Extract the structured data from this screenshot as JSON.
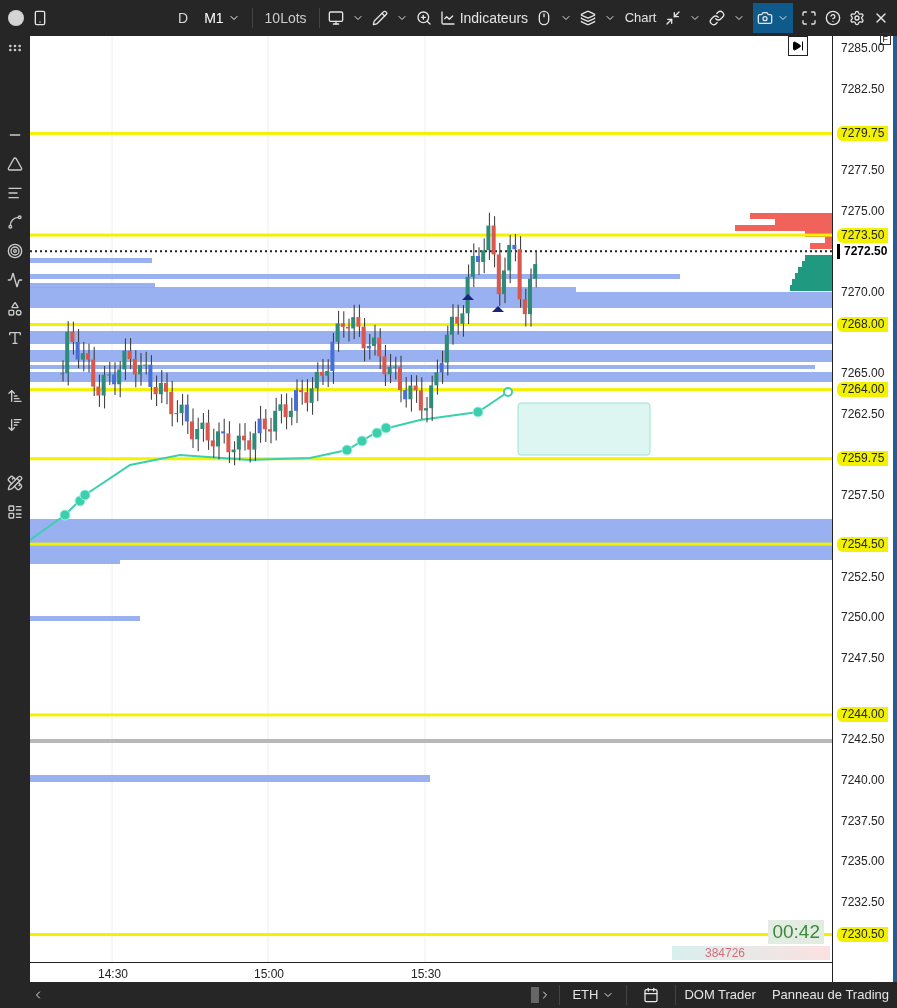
{
  "toolbar": {
    "timeframes": [
      {
        "label": "D",
        "selected": false
      },
      {
        "label": "M1",
        "selected": true
      }
    ],
    "lots": "10Lots",
    "indicators": "Indicateurs",
    "title": "Chart"
  },
  "chart": {
    "price_ticks": [
      "7285.00",
      "7282.50",
      "7277.50",
      "7275.00",
      "7270.00",
      "7265.00",
      "7262.50",
      "7257.50",
      "7252.50",
      "7250.00",
      "7247.50",
      "7242.50",
      "7240.00",
      "7237.50",
      "7235.00",
      "7232.50"
    ],
    "time_labels": [
      "14:30",
      "15:00",
      "15:30"
    ],
    "levels": [
      "7279.75",
      "7273.50",
      "7268.00",
      "7264.00",
      "7259.75",
      "7254.50",
      "7244.00",
      "7230.50"
    ],
    "current_price": "7272.50",
    "axis_badge": "F",
    "timer": "00:42",
    "volume_counter": "384726"
  },
  "bottom_bar": {
    "symbol": "ETH",
    "buttons": [
      "DOM Trader",
      "Panneau de Trading"
    ]
  }
}
